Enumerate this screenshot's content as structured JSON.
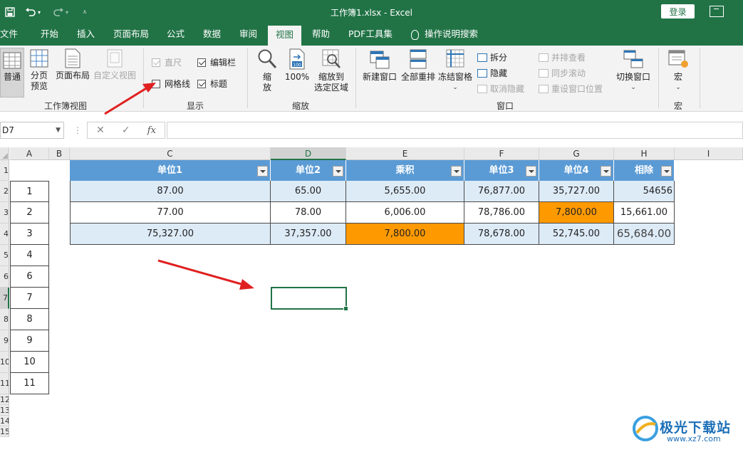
{
  "titlebar": {
    "title": "工作簿1.xlsx  -  Excel",
    "login_label": "登录",
    "icons": [
      "save-icon",
      "undo-icon",
      "redo-icon",
      "customize-qat-icon",
      "ribbon-display-options-icon"
    ]
  },
  "tabs": [
    {
      "label": "文件",
      "active": false
    },
    {
      "label": "开始",
      "active": false
    },
    {
      "label": "插入",
      "active": false
    },
    {
      "label": "页面布局",
      "active": false
    },
    {
      "label": "公式",
      "active": false
    },
    {
      "label": "数据",
      "active": false
    },
    {
      "label": "审阅",
      "active": false
    },
    {
      "label": "视图",
      "active": true
    },
    {
      "label": "帮助",
      "active": false
    },
    {
      "label": "PDF工具集",
      "active": false
    },
    {
      "label": "操作说明搜索",
      "active": false
    }
  ],
  "ribbon": {
    "workbook_views": {
      "label": "工作簿视图",
      "normal": "普通",
      "page_break_line1": "分页",
      "page_break_line2": "预览",
      "page_layout": "页面布局",
      "custom_views": "自定义视图"
    },
    "show": {
      "label": "显示",
      "ruler": "直尺",
      "ruler_checked": true,
      "ruler_enabled": false,
      "formula_bar": "编辑栏",
      "formula_bar_checked": true,
      "gridlines": "网格线",
      "gridlines_checked": false,
      "headings": "标题",
      "headings_checked": true
    },
    "zoom": {
      "label": "缩放",
      "zoom_line1": "缩",
      "zoom_line2": "放",
      "zoom100": "100%",
      "zoom_sel_line1": "缩放到",
      "zoom_sel_line2": "选定区域"
    },
    "window": {
      "label": "窗口",
      "new_window": "新建窗口",
      "arrange_all": "全部重排",
      "freeze_panes": "冻结窗格",
      "split": "拆分",
      "hide": "隐藏",
      "unhide": "取消隐藏",
      "side_by_side": "并排查看",
      "sync_scroll": "同步滚动",
      "reset_position": "重设窗口位置",
      "switch_windows": "切换窗口"
    },
    "macros": {
      "label": "宏",
      "macros": "宏"
    }
  },
  "formula_bar": {
    "name_box": "D7",
    "formula": "",
    "fx": "fx"
  },
  "sheet": {
    "selected_cell": "D7",
    "selected_column": "D",
    "selected_row": "7",
    "columns": [
      "A",
      "B",
      "C",
      "D",
      "E",
      "F",
      "G",
      "H",
      "I"
    ],
    "row_numbers": [
      "1",
      "2",
      "3",
      "4",
      "5",
      "6",
      "7",
      "8",
      "9",
      "10",
      "11",
      "12",
      "13",
      "14",
      "15"
    ],
    "a_column_values": [
      "1",
      "2",
      "3",
      "4",
      "6",
      "7",
      "8",
      "9",
      "10",
      "11"
    ],
    "table": {
      "headers": [
        "单位1",
        "单位2",
        "乘积",
        "单位3",
        "单位4",
        "相除"
      ],
      "rows": [
        [
          "87.00",
          "65.00",
          "5,655.00",
          "76,877.00",
          "35,727.00",
          "54656"
        ],
        [
          "77.00",
          "78.00",
          "6,006.00",
          "78,786.00",
          "7,800.00",
          "15,661.00"
        ],
        [
          "75,327.00",
          "37,357.00",
          "7,800.00",
          "78,678.00",
          "52,745.00",
          "65,684.00"
        ]
      ],
      "header_color": "#5b9bd5",
      "band_color": "#ddebf7",
      "highlight_color": "#ff9900"
    }
  },
  "watermark": {
    "text": "极光下载站",
    "url": "www.xz7.com"
  },
  "annotation": {
    "arrow_color": "#e02020"
  }
}
